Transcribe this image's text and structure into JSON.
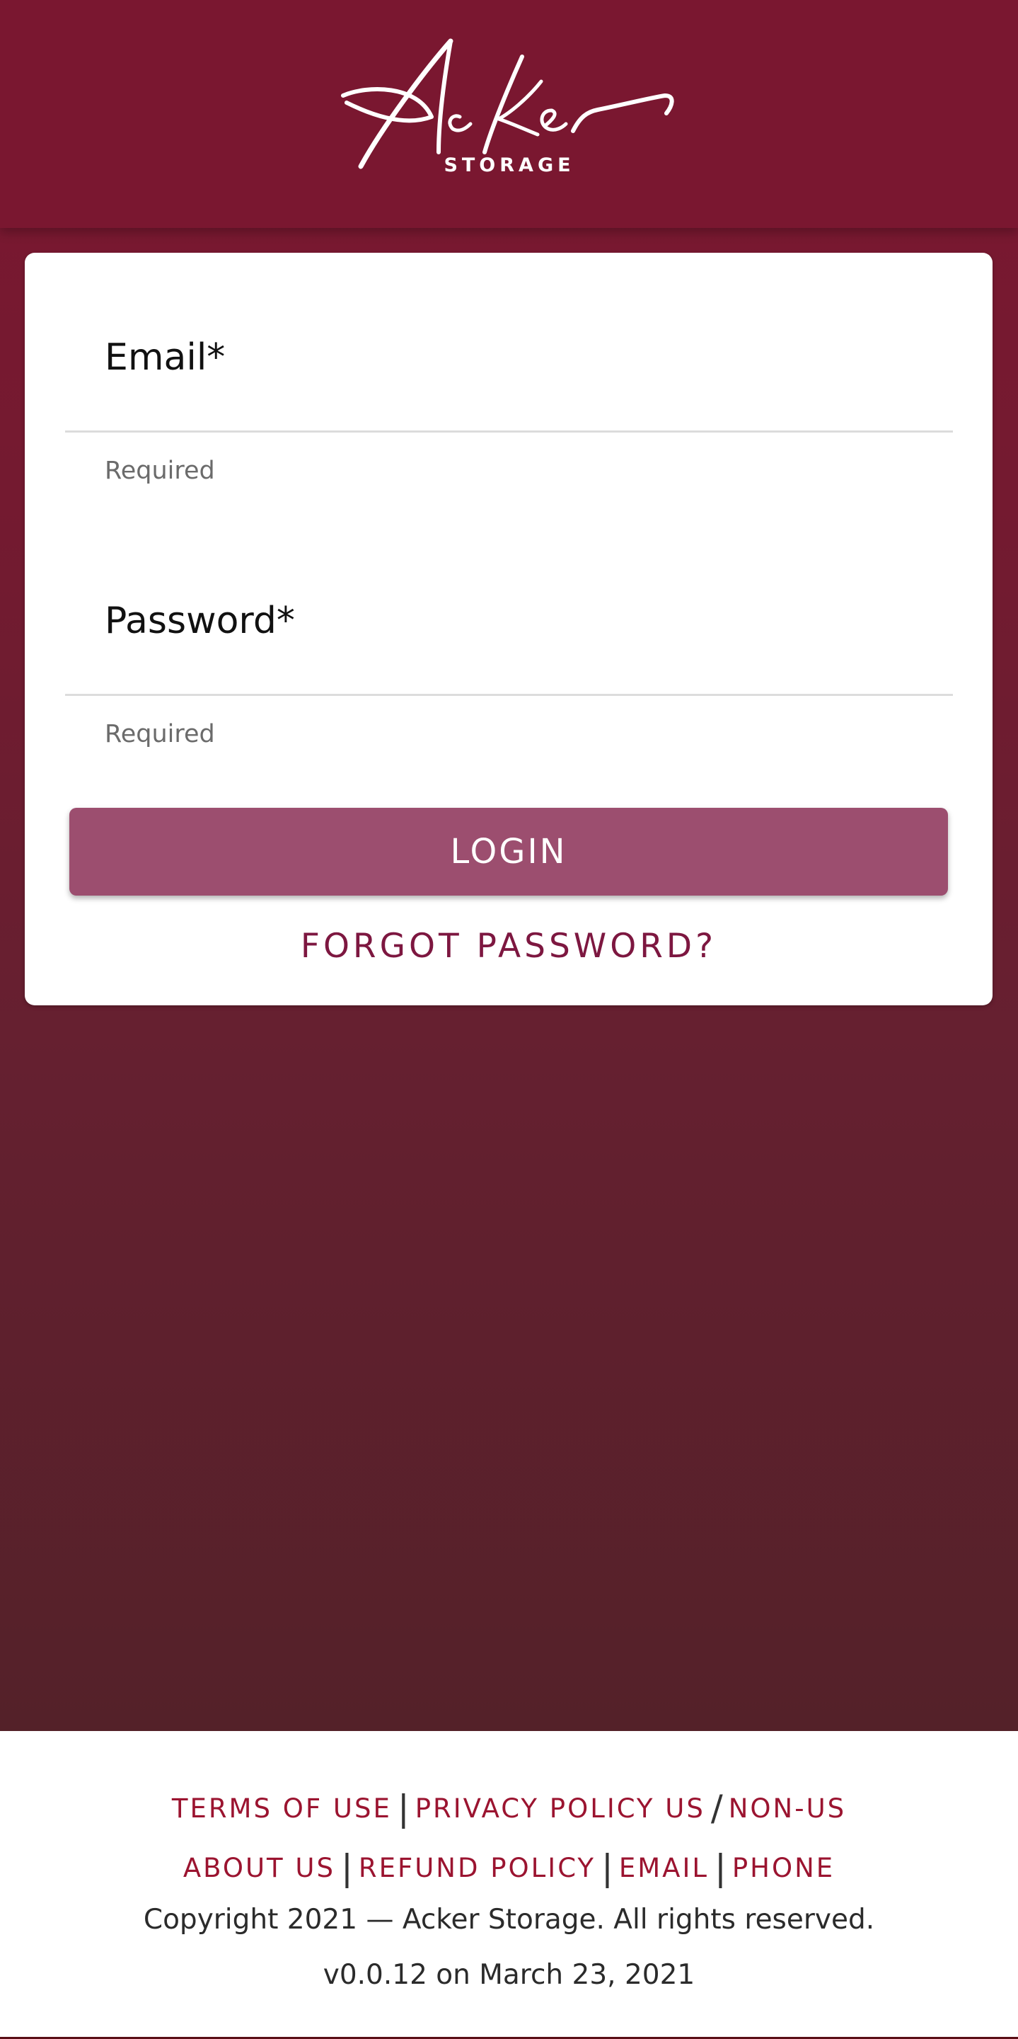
{
  "brand": {
    "script_name": "Acker",
    "subtitle": "STORAGE",
    "logo_icon": "acker-script-logo-icon"
  },
  "colors": {
    "primary": "#7a1730",
    "background_bottom": "#542129",
    "button": "#9c4e6f",
    "link": "#9b1430",
    "forgot_link": "#7d1740"
  },
  "form": {
    "email": {
      "label": "Email*",
      "value": "",
      "helper": "Required"
    },
    "password": {
      "label": "Password*",
      "value": "",
      "helper": "Required"
    },
    "login_label": "LOGIN",
    "forgot_label": "FORGOT PASSWORD?"
  },
  "footer": {
    "row1": {
      "terms": "TERMS OF USE",
      "sep1": "|",
      "privacy_us": "PRIVACY POLICY US",
      "slash": "/",
      "non_us": "NON-US"
    },
    "row2": {
      "about": "ABOUT US",
      "sep1": "|",
      "refund": "REFUND POLICY",
      "sep2": "|",
      "email": "EMAIL",
      "sep3": "|",
      "phone": "PHONE"
    },
    "copyright": "Copyright 2021 — Acker Storage. All rights reserved.",
    "version": "v0.0.12 on March 23, 2021"
  }
}
